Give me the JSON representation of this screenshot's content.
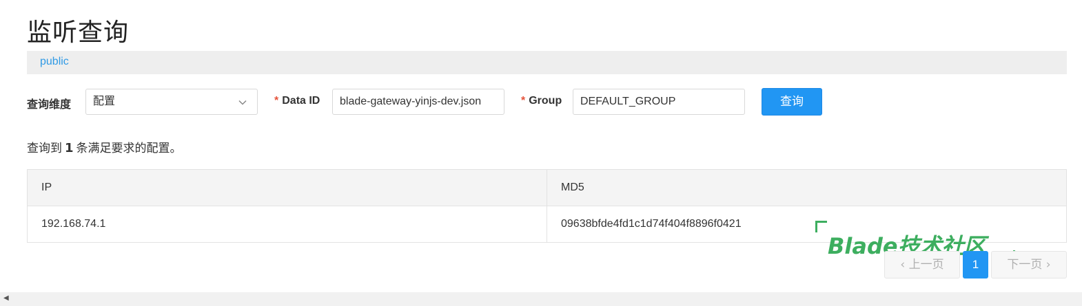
{
  "page": {
    "title": "监听查询"
  },
  "namespace": {
    "label": "public"
  },
  "query": {
    "dimension_label": "查询维度",
    "dimension_value": "配置",
    "required_mark": "*",
    "dataid_label": "Data ID",
    "dataid_value": "blade-gateway-yinjs-dev.json",
    "group_label": "Group",
    "group_value": "DEFAULT_GROUP",
    "submit_label": "查询"
  },
  "result": {
    "prefix": "查询到",
    "count": "1",
    "suffix": "条满足要求的配置。"
  },
  "table": {
    "headers": [
      "IP",
      "MD5"
    ],
    "rows": [
      [
        "192.168.74.1",
        "09638bfde4fd1c1d74f404f8896f0421"
      ]
    ]
  },
  "watermark": {
    "text": "Blade技术社区"
  },
  "pagination": {
    "prev_label": "上一页",
    "current_page": "1",
    "next_label": "下一页"
  },
  "colors": {
    "primary": "#2196f3",
    "link": "#2f9ae5",
    "required": "#e5533b",
    "watermark": "#3dae5f"
  }
}
